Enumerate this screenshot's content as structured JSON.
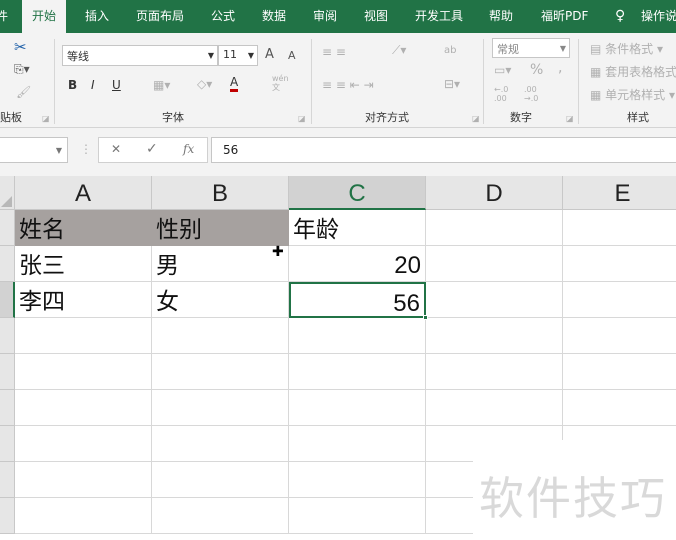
{
  "ribbon_tabs": [
    "件",
    "开始",
    "插入",
    "页面布局",
    "公式",
    "数据",
    "审阅",
    "视图",
    "开发工具",
    "帮助",
    "福昕PDF",
    "操作说"
  ],
  "tell_me_icon": "lightbulb-icon",
  "clipboard": {
    "label": "贴板"
  },
  "font": {
    "name": "等线",
    "size": "11",
    "label": "字体",
    "bold": "B",
    "italic": "I",
    "underline": "U",
    "phonetic": "wén\n文",
    "grow": "A",
    "shrink": "A",
    "color": "A",
    "font_color": "#c00000"
  },
  "alignment": {
    "label": "对齐方式",
    "wrap": "ab"
  },
  "number": {
    "format": "常规",
    "percent": "%",
    "comma": ",",
    "label": "数字",
    "inc": "←.0 .00",
    "dec": ".00 →.0"
  },
  "styles": {
    "conditional": "条件格式",
    "table": "套用表格格式",
    "cell": "单元格样式",
    "label": "样式"
  },
  "formula_bar": {
    "value": "56",
    "cancel": "✕",
    "enter": "✓",
    "fx": "fx"
  },
  "columns": [
    "A",
    "B",
    "C",
    "D",
    "E"
  ],
  "selected_column": "C",
  "rows": [
    [
      "姓名",
      "性别",
      "年龄"
    ],
    [
      "张三",
      "男",
      "20"
    ],
    [
      "李四",
      "女",
      "56"
    ]
  ],
  "header_fill": "#a6a19f",
  "accent": "#217346",
  "watermark": "软件技巧"
}
